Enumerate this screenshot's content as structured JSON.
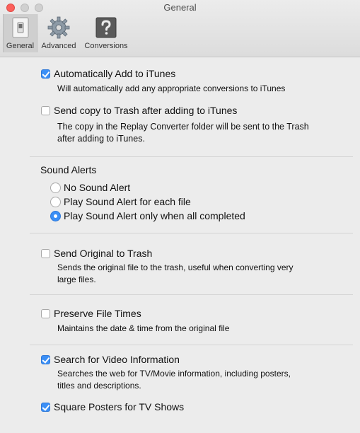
{
  "window": {
    "title": "General"
  },
  "toolbar": {
    "items": [
      {
        "label": "General",
        "icon": "light-switch-icon",
        "selected": true
      },
      {
        "label": "Advanced",
        "icon": "gear-icon",
        "selected": false
      },
      {
        "label": "Conversions",
        "icon": "question-mark-icon",
        "selected": false
      }
    ]
  },
  "settings": {
    "add_to_itunes": {
      "label": "Automatically Add to iTunes",
      "checked": true,
      "description": "Will automatically add any appropriate conversions to iTunes"
    },
    "send_copy_trash": {
      "label": "Send copy to Trash after adding to iTunes",
      "checked": false,
      "description_line1": "The copy in the Replay Converter folder will be sent to the Trash",
      "description_line2": "after adding to iTunes."
    },
    "sound_alerts": {
      "heading": "Sound Alerts",
      "options": [
        {
          "label": "No Sound Alert",
          "selected": false
        },
        {
          "label": "Play Sound Alert for each file",
          "selected": false
        },
        {
          "label": "Play Sound Alert only when all completed",
          "selected": true
        }
      ]
    },
    "send_original_trash": {
      "label": "Send Original to Trash",
      "checked": false,
      "description_line1": "Sends the original file to the trash, useful when converting very",
      "description_line2": "large files."
    },
    "preserve_file_times": {
      "label": "Preserve File Times",
      "checked": false,
      "description": "Maintains the date & time from the original file"
    },
    "search_video_info": {
      "label": "Search for Video Information",
      "checked": true,
      "description_line1": "Searches the web for TV/Movie information, including posters,",
      "description_line2": "titles and descriptions."
    },
    "square_posters": {
      "label": "Square Posters for TV Shows",
      "checked": true
    }
  },
  "colors": {
    "accent": "#3b8ff6",
    "close": "#fc605b",
    "background": "#ececec"
  }
}
